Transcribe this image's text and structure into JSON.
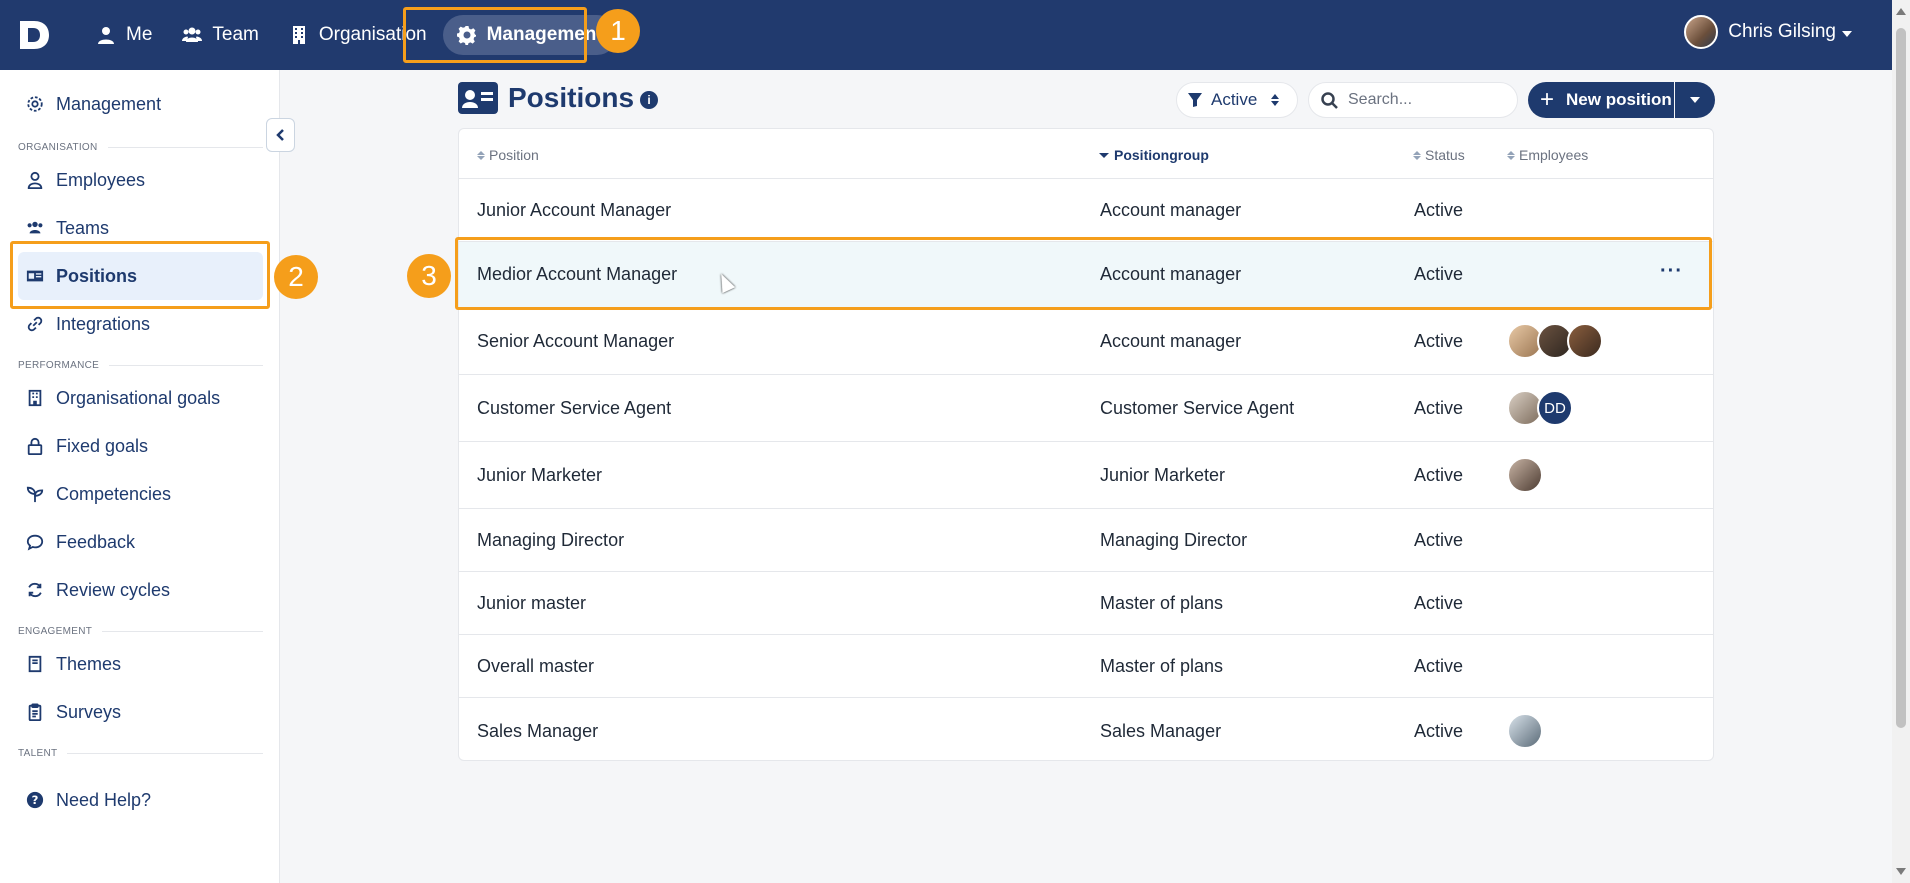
{
  "topnav": {
    "items": [
      {
        "label": "Me",
        "icon": "user-icon"
      },
      {
        "label": "Team",
        "icon": "users-icon"
      },
      {
        "label": "Organisation",
        "icon": "building-icon"
      },
      {
        "label": "Management",
        "icon": "gear-icon",
        "active": true
      }
    ],
    "user_name": "Chris Gilsing"
  },
  "callouts": [
    "1",
    "2",
    "3"
  ],
  "sidebar": {
    "header": "Management",
    "sections": {
      "organisation": "ORGANISATION",
      "performance": "PERFORMANCE",
      "engagement": "ENGAGEMENT",
      "talent": "TALENT"
    },
    "items": {
      "employees": "Employees",
      "teams": "Teams",
      "positions": "Positions",
      "integrations": "Integrations",
      "org_goals": "Organisational goals",
      "fixed_goals": "Fixed goals",
      "competencies": "Competencies",
      "feedback": "Feedback",
      "review_cycles": "Review cycles",
      "themes": "Themes",
      "surveys": "Surveys",
      "help": "Need Help?"
    }
  },
  "main": {
    "title": "Positions",
    "info": "i",
    "filter_value": "Active",
    "search_placeholder": "Search...",
    "new_button": "New position",
    "plus": "+",
    "columns": [
      "Position",
      "Positiongroup",
      "Status",
      "Employees"
    ],
    "more": "···",
    "rows": [
      {
        "position": "Junior Account Manager",
        "group": "Account manager",
        "status": "Active",
        "avatars": []
      },
      {
        "position": "Medior Account Manager",
        "group": "Account manager",
        "status": "Active",
        "avatars": []
      },
      {
        "position": "Senior Account Manager",
        "group": "Account manager",
        "status": "Active",
        "avatars": [
          "a1",
          "a2",
          "a3"
        ]
      },
      {
        "position": "Customer Service Agent",
        "group": "Customer Service Agent",
        "status": "Active",
        "avatars": [
          "a4",
          "DD"
        ]
      },
      {
        "position": "Junior Marketer",
        "group": "Junior Marketer",
        "status": "Active",
        "avatars": [
          "a5"
        ]
      },
      {
        "position": "Managing Director",
        "group": "Managing Director",
        "status": "Active",
        "avatars": []
      },
      {
        "position": "Junior master",
        "group": "Master of plans",
        "status": "Active",
        "avatars": []
      },
      {
        "position": "Overall master",
        "group": "Master of plans",
        "status": "Active",
        "avatars": []
      },
      {
        "position": "Sales Manager",
        "group": "Sales Manager",
        "status": "Active",
        "avatars": [
          "a6"
        ]
      }
    ]
  },
  "colors": {
    "brand": "#213a6e",
    "accent": "#f59e1b",
    "hover_row": "#f0f8fa"
  }
}
